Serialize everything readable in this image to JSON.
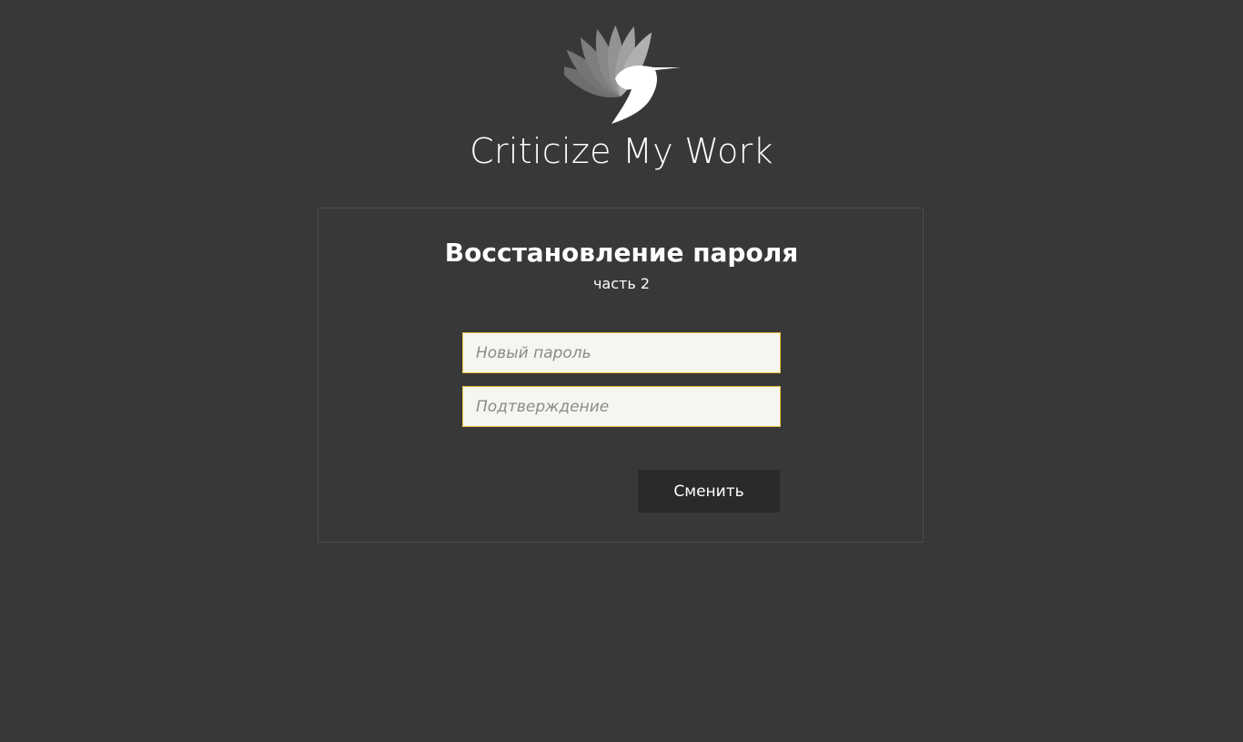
{
  "brand": {
    "name": "Criticize My Work",
    "logo_icon": "hummingbird-logo-icon"
  },
  "form": {
    "title": "Восстановление пароля",
    "subtitle": "часть 2",
    "new_password_placeholder": "Новый пароль",
    "new_password_value": "",
    "confirm_placeholder": "Подтверждение",
    "confirm_value": "",
    "submit_label": "Сменить"
  },
  "colors": {
    "background": "#383838",
    "card_border": "#4e4e4e",
    "input_border": "#e8be3a",
    "input_background": "#f6f6f1",
    "button_background": "#2a2a2a",
    "text": "#ffffff"
  }
}
